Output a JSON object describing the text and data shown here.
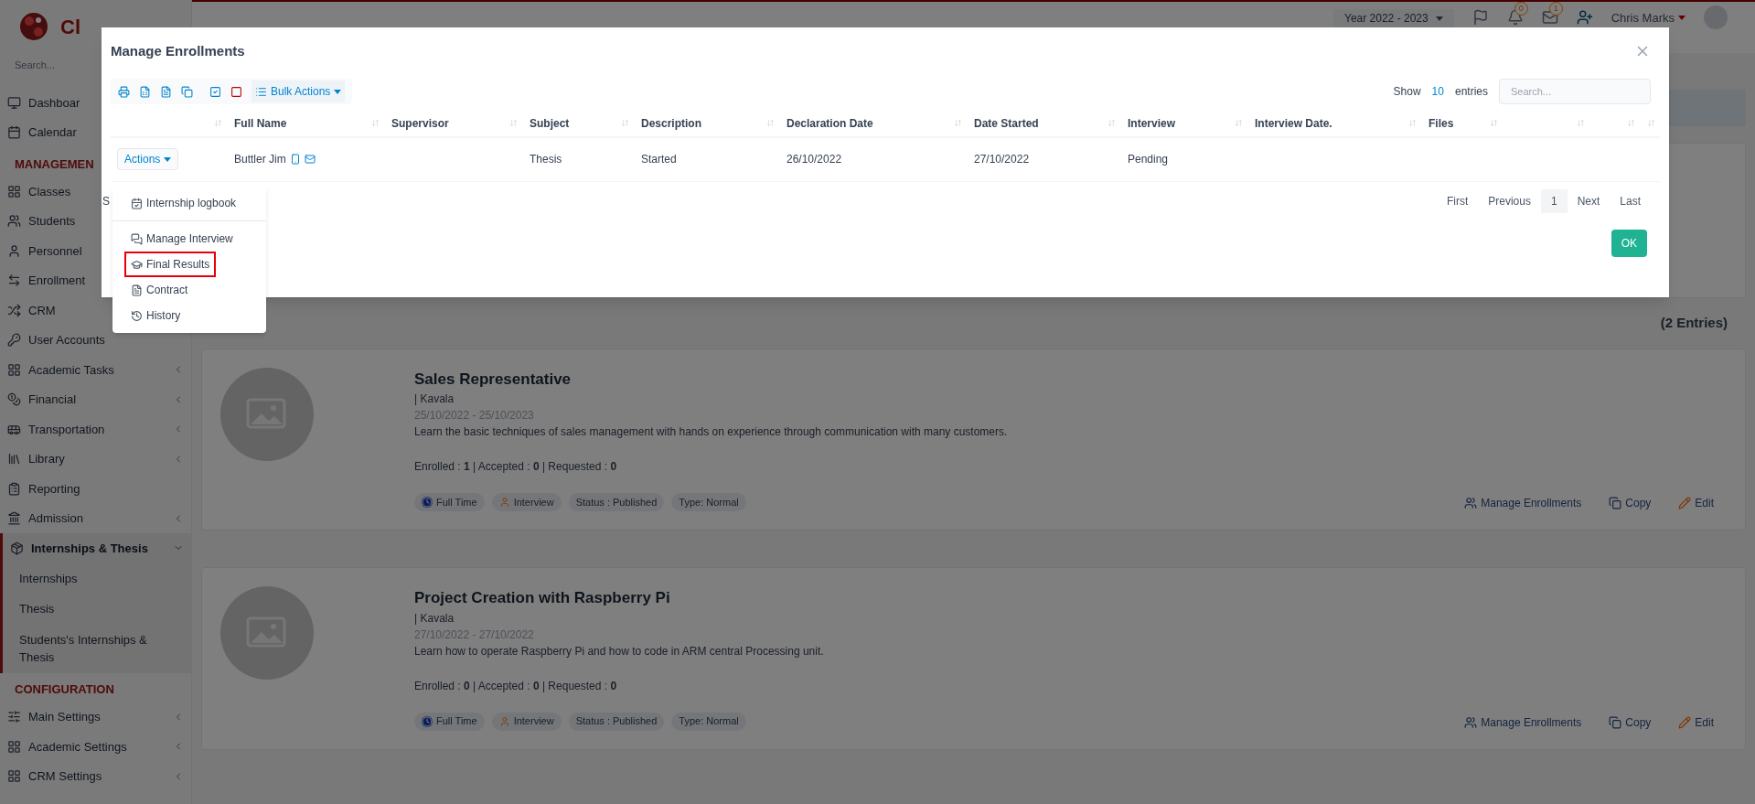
{
  "topbar": {
    "year": "Year 2022 - 2023",
    "notifications": "0",
    "messages": "1",
    "user": "Chris Marks"
  },
  "sidebar": {
    "logo": "Cl",
    "search_placeholder": "Search...",
    "items": [
      {
        "kind": "link",
        "label": "Dashboar",
        "selected": false
      },
      {
        "kind": "link",
        "label": "Calendar",
        "selected": false
      },
      {
        "kind": "section",
        "label": "MANAGEMEN"
      },
      {
        "kind": "link",
        "label": "Classes",
        "selected": false
      },
      {
        "kind": "link",
        "label": "Students",
        "selected": false
      },
      {
        "kind": "link",
        "label": "Personnel",
        "selected": false
      },
      {
        "kind": "link",
        "label": "Enrollment",
        "selected": false
      },
      {
        "kind": "link",
        "label": "CRM",
        "selected": false
      },
      {
        "kind": "link",
        "label": "User Accounts",
        "selected": false
      },
      {
        "kind": "group",
        "label": "Academic Tasks",
        "expanded": false,
        "selected": false
      },
      {
        "kind": "group",
        "label": "Financial",
        "expanded": false,
        "selected": false
      },
      {
        "kind": "group",
        "label": "Transportation",
        "expanded": false,
        "selected": false
      },
      {
        "kind": "group",
        "label": "Library",
        "expanded": false,
        "selected": false
      },
      {
        "kind": "link",
        "label": "Reporting",
        "selected": false
      },
      {
        "kind": "group",
        "label": "Admission",
        "expanded": false,
        "selected": false
      },
      {
        "kind": "group",
        "label": "Internships & Thesis",
        "expanded": true,
        "selected": true,
        "children": [
          {
            "label": "Internships",
            "selected": false
          },
          {
            "label": "Thesis",
            "selected": false
          },
          {
            "label": "Students's Internships & Thesis",
            "selected": false
          }
        ]
      },
      {
        "kind": "section",
        "label": "CONFIGURATION"
      },
      {
        "kind": "group",
        "label": "Main Settings",
        "expanded": false,
        "selected": false
      },
      {
        "kind": "group",
        "label": "Academic Settings",
        "expanded": false,
        "selected": false
      },
      {
        "kind": "group",
        "label": "CRM Settings",
        "expanded": false,
        "selected": false
      }
    ]
  },
  "page": {
    "entries": "(2 Entries)",
    "cards": [
      {
        "title": "Sales Representative",
        "location": "| Kavala",
        "dates": "25/10/2022 - 25/10/2023",
        "description": "Learn the basic techniques of sales management with hands on experience through communication with many customers.",
        "stats": "Enrolled : **1** | Accepted : **0** | Requested : **0**",
        "tags": [
          {
            "kind": "clock",
            "label": "Full Time"
          },
          {
            "kind": "person",
            "label": "Interview"
          },
          {
            "kind": "plain",
            "label": "Status : Published"
          },
          {
            "kind": "plain",
            "label": "Type: Normal"
          }
        ],
        "actions": [
          {
            "kind": "users",
            "label": "Manage Enrollments"
          },
          {
            "kind": "copy",
            "label": "Copy"
          },
          {
            "kind": "edit",
            "label": "Edit"
          }
        ]
      },
      {
        "title": "Project Creation with Raspberry Pi",
        "location": "| Kavala",
        "dates": "27/10/2022 - 27/10/2022",
        "description": "Learn how to operate Raspberry Pi and how to code in ARM central Processing unit.",
        "stats": "Enrolled : **0** | Accepted : **0** | Requested : **0**",
        "tags": [
          {
            "kind": "clock",
            "label": "Full Time"
          },
          {
            "kind": "person",
            "label": "Interview"
          },
          {
            "kind": "plain",
            "label": "Status : Published"
          },
          {
            "kind": "plain",
            "label": "Type: Normal"
          }
        ],
        "actions": [
          {
            "kind": "users",
            "label": "Manage Enrollments"
          },
          {
            "kind": "copy",
            "label": "Copy"
          },
          {
            "kind": "edit",
            "label": "Edit"
          }
        ]
      }
    ]
  },
  "modal": {
    "title": "Manage Enrollments",
    "bulk_actions": "Bulk Actions",
    "show": "Show",
    "page_size": "10",
    "entries": "entries",
    "search_placeholder": "Search...",
    "table": {
      "columns": [
        "",
        "Full Name",
        "Supervisor",
        "Subject",
        "Description",
        "Declaration Date",
        "Date Started",
        "Interview",
        "Interview Date.",
        "Files",
        "",
        "",
        ""
      ],
      "rows": [
        {
          "cells": [
            "Actions",
            "Buttler Jim",
            "",
            "Thesis",
            "Started",
            "26/10/2022",
            "27/10/2022",
            "Pending",
            "",
            "",
            "",
            "",
            ""
          ]
        }
      ]
    },
    "info": "S",
    "menu": [
      {
        "kind": "logbook",
        "label": "Internship logbook",
        "highlighted": false
      },
      {
        "kind": "interview",
        "label": "Manage Interview",
        "highlighted": false
      },
      {
        "kind": "results",
        "label": "Final Results",
        "highlighted": true
      },
      {
        "kind": "contract",
        "label": "Contract",
        "highlighted": false
      },
      {
        "kind": "history",
        "label": "History",
        "highlighted": false
      }
    ],
    "pagination": [
      {
        "label": "First",
        "selected": false
      },
      {
        "label": "Previous",
        "selected": false
      },
      {
        "label": "1",
        "selected": true
      },
      {
        "label": "Next",
        "selected": false
      },
      {
        "label": "Last",
        "selected": false
      }
    ],
    "ok": "OK"
  }
}
